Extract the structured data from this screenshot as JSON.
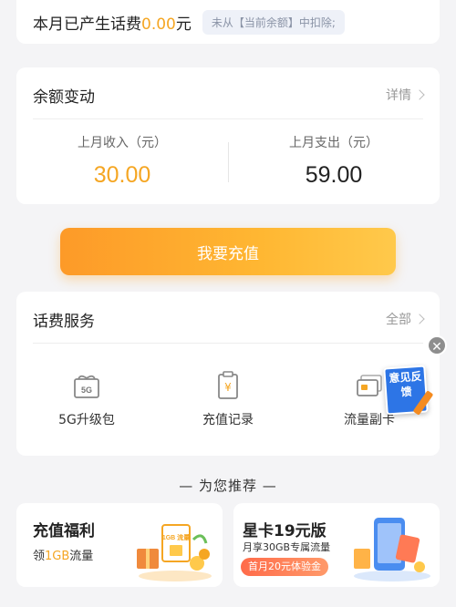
{
  "usage": {
    "prefix": "本月已产生话费",
    "amount": "0.00",
    "suffix": "元",
    "note": "未从【当前余额】中扣除;"
  },
  "balance": {
    "title": "余额变动",
    "detail_link": "详情",
    "income_label": "上月收入（元）",
    "income_value": "30.00",
    "expense_label": "上月支出（元）",
    "expense_value": "59.00"
  },
  "recharge_button": "我要充值",
  "services": {
    "title": "话费服务",
    "all_link": "全部",
    "items": [
      {
        "label": "5G升级包",
        "icon": "gift-5g-icon",
        "icon_text": "5G"
      },
      {
        "label": "充值记录",
        "icon": "receipt-icon",
        "icon_text": "¥"
      },
      {
        "label": "流量副卡",
        "icon": "sim-card-icon",
        "icon_text": ""
      }
    ]
  },
  "feedback": {
    "label": "意见反馈"
  },
  "recommend": {
    "heading": "— 为您推荐 —",
    "cards": [
      {
        "title": "充值福利",
        "sub_prefix": "领",
        "sub_highlight": "1GB",
        "sub_suffix": "流量",
        "illus_text": "1GB 流量"
      },
      {
        "title": "星卡19元版",
        "sub": "月享30GB专属流量",
        "pill": "首月20元体验金"
      }
    ]
  },
  "colors": {
    "accent": "#f5a623",
    "button_start": "#fd9a28",
    "button_end": "#ffc94b",
    "feedback_blue": "#2d75e6"
  }
}
